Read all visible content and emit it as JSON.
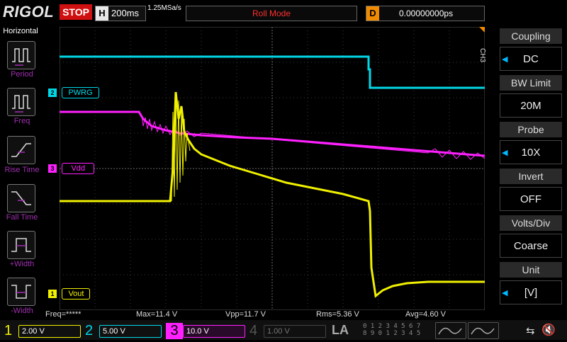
{
  "header": {
    "brand": "RIGOL",
    "run_state": "STOP",
    "timebase_key": "H",
    "timebase": "200ms",
    "sample_rate": "1.25MSa/s",
    "mode": "Roll Mode",
    "delay_key": "D",
    "delay": "0.00000000ps"
  },
  "left_menu": {
    "title": "Horizontal",
    "items": [
      "Period",
      "Freq",
      "Rise Time",
      "Fall Time",
      "+Width",
      "-Width"
    ]
  },
  "channel_labels": {
    "ch2": {
      "num": "2",
      "text": "PWRG"
    },
    "ch3": {
      "num": "3",
      "text": "Vdd"
    },
    "ch1": {
      "num": "1",
      "text": "Vout"
    }
  },
  "right_menu": {
    "channel_tag": "CH3",
    "items": [
      {
        "label": "Coupling",
        "value": "DC"
      },
      {
        "label": "BW Limit",
        "value": "20M"
      },
      {
        "label": "Probe",
        "value": "10X"
      },
      {
        "label": "Invert",
        "value": "OFF"
      },
      {
        "label": "Volts/Div",
        "value": "Coarse"
      },
      {
        "label": "Unit",
        "value": "[V]"
      }
    ]
  },
  "measurements": {
    "freq": "Freq=*****",
    "max": "Max=11.4 V",
    "vpp": "Vpp=11.7 V",
    "rms": "Rms=5.36 V",
    "avg": "Avg=4.60 V"
  },
  "channels": [
    {
      "num": "1",
      "scale": "2.00 V",
      "color": "#f0f000"
    },
    {
      "num": "2",
      "scale": "5.00 V",
      "color": "#00d8e8"
    },
    {
      "num": "3",
      "scale": "10.0 V",
      "color": "#ff20ff"
    },
    {
      "num": "4",
      "scale": "1.00 V",
      "color": "#555555"
    }
  ],
  "la": {
    "label": "LA",
    "digits_top": "0 1 2 3  4 5 6 7",
    "digits_bottom": "8 9 0 1  2 3 4 5"
  },
  "colors": {
    "ch1": "#f0f000",
    "ch2": "#00d8e8",
    "ch3": "#ff20ff",
    "accent": "#f08a00",
    "stop": "#d01010"
  }
}
